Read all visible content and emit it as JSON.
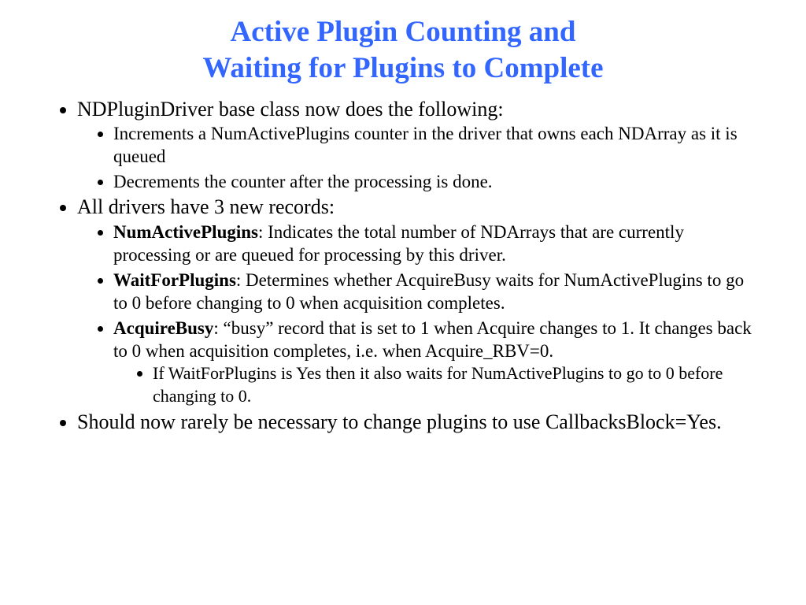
{
  "title_line1": "Active Plugin Counting and",
  "title_line2": "Waiting for Plugins to Complete",
  "l1_1": "NDPluginDriver base class now does the following:",
  "l2_1a": "Increments a NumActivePlugins counter in the driver that owns each NDArray as it is queued",
  "l2_1b": "Decrements the counter after the processing is done.",
  "l1_2": "All drivers have 3 new records:",
  "rec1_name": "NumActivePlugins",
  "rec1_desc": ": Indicates the total number of NDArrays that are currently processing or are queued for processing by this driver.",
  "rec2_name": "WaitForPlugins",
  "rec2_desc": ": Determines whether AcquireBusy waits for NumActivePlugins to go to 0 before changing to 0 when acquisition completes.",
  "rec3_name": "AcquireBusy",
  "rec3_desc": ": “busy” record that is set to 1 when Acquire changes to 1. It changes back to 0 when acquisition completes, i.e. when Acquire_RBV=0.",
  "rec3_sub": "If WaitForPlugins is Yes then it also waits for NumActivePlugins to go to 0 before changing to 0.",
  "l1_3": "Should now rarely be necessary to change plugins to use CallbacksBlock=Yes."
}
